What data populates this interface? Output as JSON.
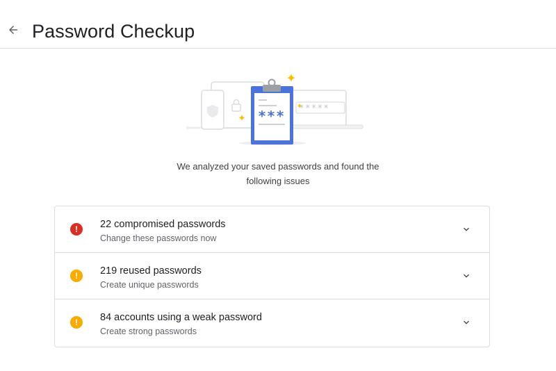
{
  "header": {
    "title": "Password Checkup",
    "back_icon": "arrow-back-icon"
  },
  "summary": {
    "line1": "We analyzed your saved passwords and found the",
    "line2": "following issues"
  },
  "illustration": {
    "masked_text": "***",
    "field_text": "*****"
  },
  "issues": [
    {
      "title": "22 compromised passwords",
      "subtitle": "Change these passwords now",
      "icon": "error-icon",
      "color": "#d93025"
    },
    {
      "title": "219 reused passwords",
      "subtitle": "Create unique passwords",
      "icon": "warning-icon",
      "color": "#f9ab00"
    },
    {
      "title": "84 accounts using a weak password",
      "subtitle": "Create strong passwords",
      "icon": "warning-icon",
      "color": "#f9ab00"
    }
  ],
  "colors": {
    "accent_blue": "#4c73d9",
    "sparkle": "#fbbc04",
    "border": "#dadce0"
  }
}
